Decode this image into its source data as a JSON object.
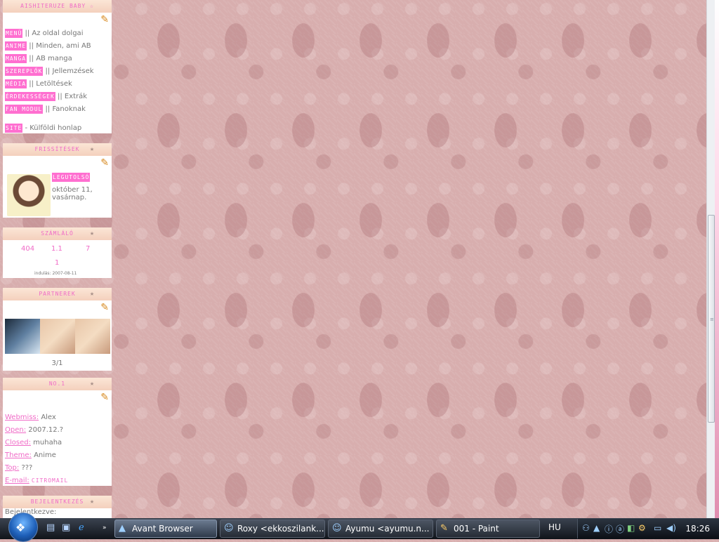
{
  "sidebar": {
    "box1": {
      "title": "AISHITERUZE BABY ☆",
      "menu": [
        {
          "tag": "MENÜ",
          "text": "|| Az oldal dolgai"
        },
        {
          "tag": "ANIME",
          "text": "|| Minden, ami AB"
        },
        {
          "tag": "MANGA",
          "text": "|| AB manga"
        },
        {
          "tag": "SZEREPLŐK",
          "text": "|| Jellemzések"
        },
        {
          "tag": "MÉDIA",
          "text": "|| Letöltések"
        },
        {
          "tag": "ÉRDEKESSÉGEK",
          "text": "|| Extrák"
        },
        {
          "tag": "FAN MODUL",
          "text": "|| Fanoknak"
        }
      ],
      "site_tag": "SITE",
      "site_text": "- Külföldi honlap"
    },
    "box2": {
      "title": "FRISSÍTÉSEK",
      "latest_tag": "LEGUTOLSÓ",
      "date": "október 11, vasárnap."
    },
    "box3": {
      "title": "SZÁMLÁLÓ",
      "counts": [
        "404",
        "1.1",
        "7",
        "1"
      ],
      "start_label": "indulás: 2007-08-11"
    },
    "box4": {
      "title": "PARTNEREK",
      "page": "3/1"
    },
    "box5": {
      "title": "NO.1",
      "fields": [
        {
          "label": "Webmiss:",
          "value": "Alex"
        },
        {
          "label": "Open:",
          "value": "2007.12.?"
        },
        {
          "label": "Closed:",
          "value": "muhaha"
        },
        {
          "label": "Theme:",
          "value": "Anime"
        },
        {
          "label": "Top:",
          "value": "???"
        },
        {
          "label": "E-mail:",
          "value": "CITROMAIL"
        }
      ]
    },
    "box6": {
      "title": "BEJELENTKEZÉS",
      "login_label": "Bejelentkezve:"
    }
  },
  "taskbar": {
    "tasks": [
      {
        "label": "Avant Browser",
        "icon": "avant-browser-icon"
      },
      {
        "label": "Roxy <ekkoszilank...",
        "icon": "messenger-icon"
      },
      {
        "label": "Ayumu <ayumu.n...",
        "icon": "messenger-icon"
      },
      {
        "label": "001 - Paint",
        "icon": "paint-icon"
      }
    ],
    "language": "HU",
    "clock": "18:26"
  },
  "colors": {
    "accent_pink": "#ff6fd0",
    "link_pink": "#f06bc7",
    "background": "#d8aeae"
  }
}
